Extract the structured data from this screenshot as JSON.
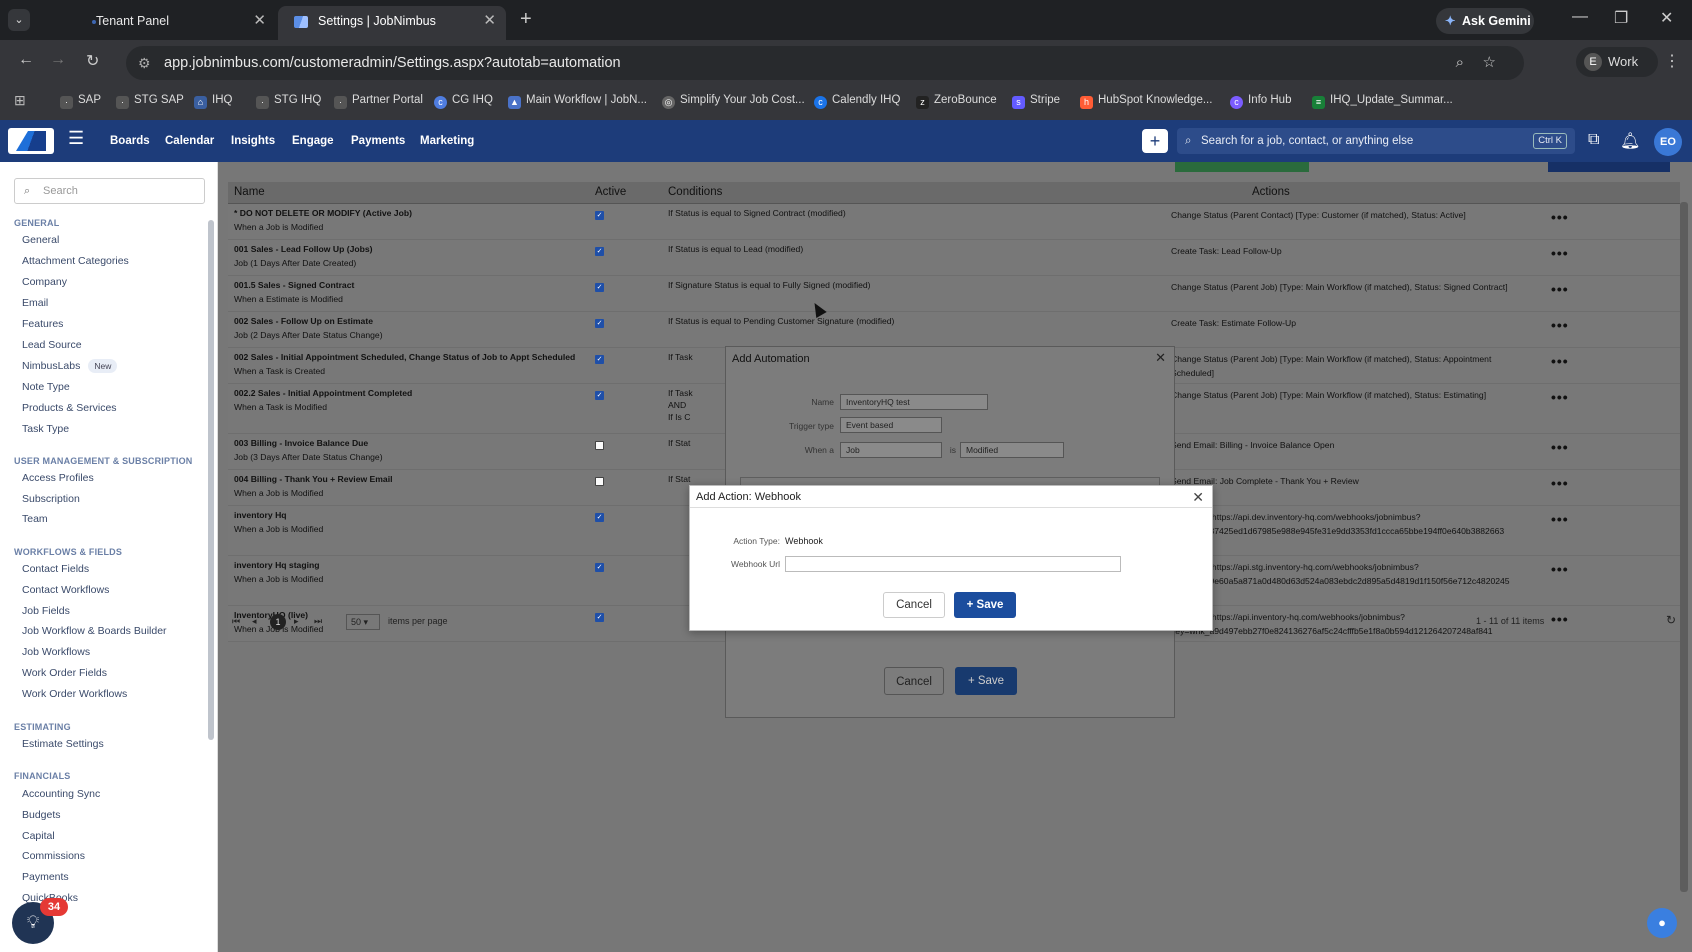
{
  "browser": {
    "tabs": [
      {
        "title": "Tenant Panel"
      },
      {
        "title": "Settings | JobNimbus"
      }
    ],
    "url": "app.jobnimbus.com/customeradmin/Settings.aspx?autotab=automation",
    "ask_gemini": "Ask Gemini",
    "profile_initial": "E",
    "profile_label": "Work",
    "bookmarks": [
      "SAP",
      "STG SAP",
      "IHQ",
      "STG IHQ",
      "Partner Portal",
      "CG IHQ",
      "Main Workflow | JobN...",
      "Simplify Your Job Cost...",
      "Calendly IHQ",
      "ZeroBounce",
      "Stripe",
      "HubSpot Knowledge...",
      "Info Hub",
      "IHQ_Update_Summar..."
    ]
  },
  "app": {
    "nav": [
      "Boards",
      "Calendar",
      "Insights",
      "Engage",
      "Payments",
      "Marketing"
    ],
    "search_placeholder": "Search for a job, contact, or anything else",
    "shortcut": "Ctrl K",
    "avatar": "EO"
  },
  "sidebar": {
    "search_placeholder": "Search",
    "sections": [
      {
        "title": "GENERAL",
        "items": [
          "General",
          "Attachment Categories",
          "Company",
          "Email",
          "Features",
          "Lead Source",
          "NimbusLabs",
          "Note Type",
          "Products & Services",
          "Task Type"
        ]
      },
      {
        "title": "USER MANAGEMENT & SUBSCRIPTION",
        "items": [
          "Access Profiles",
          "Subscription",
          "Team"
        ]
      },
      {
        "title": "WORKFLOWS & FIELDS",
        "items": [
          "Contact Fields",
          "Contact Workflows",
          "Job Fields",
          "Job Workflow & Boards Builder",
          "Job Workflows",
          "Work Order Fields",
          "Work Order Workflows"
        ]
      },
      {
        "title": "ESTIMATING",
        "items": [
          "Estimate Settings"
        ]
      },
      {
        "title": "FINANCIALS",
        "items": [
          "Accounting Sync",
          "Budgets",
          "Capital",
          "Commissions",
          "Payments",
          "QuickBooks"
        ]
      }
    ],
    "new_badge": "New",
    "help_count": "34"
  },
  "table": {
    "headers": [
      "Name",
      "Active",
      "Conditions",
      "Actions"
    ],
    "rows": [
      {
        "name": "* DO NOT DELETE OR MODIFY (Active Job)",
        "sub": "When a Job is Modified",
        "active": true,
        "cond": "If Status is equal to Signed Contract (modified)",
        "act": "Change Status (Parent Contact) [Type: Customer (if matched), Status: Active]"
      },
      {
        "name": "001 Sales - Lead Follow Up (Jobs)",
        "sub": "Job (1 Days After Date Created)",
        "active": true,
        "cond": "If Status is equal to Lead (modified)",
        "act": "Create Task: Lead Follow-Up"
      },
      {
        "name": "001.5 Sales - Signed Contract",
        "sub": "When a Estimate is Modified",
        "active": true,
        "cond": "If Signature Status is equal to Fully Signed (modified)",
        "act": "Change Status (Parent Job) [Type: Main Workflow (if matched), Status: Signed Contract]"
      },
      {
        "name": "002 Sales - Follow Up on Estimate",
        "sub": "Job (2 Days After Date Status Change)",
        "active": true,
        "cond": "If Status is equal to Pending Customer Signature (modified)",
        "act": "Create Task: Estimate Follow-Up"
      },
      {
        "name": "002 Sales - Initial Appointment Scheduled, Change Status of Job to Appt Scheduled",
        "sub": "When a Task is Created",
        "active": true,
        "cond": "If Task",
        "act": "Change Status (Parent Job) [Type: Main Workflow (if matched), Status: Appointment Scheduled]"
      },
      {
        "name": "002.2 Sales - Initial Appointment Completed",
        "sub": "When a Task is Modified",
        "active": true,
        "cond": "If Task",
        "cond2": "AND",
        "cond3": "If Is C",
        "act": "Change Status (Parent Job) [Type: Main Workflow (if matched), Status: Estimating]"
      },
      {
        "name": "003 Billing - Invoice Balance Due",
        "sub": "Job (3 Days After Date Status Change)",
        "active": false,
        "cond": "If Stat",
        "act": "Send Email: Billing - Invoice Balance Open"
      },
      {
        "name": "004 Billing - Thank You + Review Email",
        "sub": "When a Job is Modified",
        "active": false,
        "cond": "If Stat",
        "act": "Send Email: Job Complete - Thank You + Review"
      },
      {
        "name": "inventory Hq",
        "sub": "When a Job is Modified",
        "active": true,
        "cond": "",
        "act": "Webhook: https://api.dev.inventory-hq.com/webhooks/jobnimbus?key=whk_37425ed1d67985e988e945fe31e9dd3353fd1ccca65bbe194ff0e640b3882663"
      },
      {
        "name": "inventory Hq staging",
        "sub": "When a Job is Modified",
        "active": true,
        "cond": "",
        "act": "Webhook: https://api.stg.inventory-hq.com/webhooks/jobnimbus?key=whk_9e60a5a871a0d480d63d524a083ebdc2d895a5d4819d1f150f56e712c4820245"
      },
      {
        "name": "InventoryHQ (live)",
        "sub": "When a Job is Modified",
        "active": true,
        "cond": "",
        "act": "Webhook: https://api.inventory-hq.com/webhooks/jobnimbus?key=whk_a9d497ebb27f0e824136276af5c24cfffb5e1f8a0b594d121264207248af841"
      }
    ],
    "page": "1",
    "per_page": "50",
    "per_page_label": "items per page",
    "summary": "1 - 11 of 11 items"
  },
  "add_automation": {
    "title": "Add Automation",
    "name_label": "Name",
    "name_value": "InventoryHQ test",
    "trigger_label": "Trigger type",
    "trigger_value": "Event based",
    "when_label": "When a",
    "when_value": "Job",
    "is_label": "is",
    "is_value": "Modified",
    "cancel": "Cancel",
    "save": "+ Save"
  },
  "add_action": {
    "title": "Add Action: Webhook",
    "type_label": "Action Type:",
    "type_value": "Webhook",
    "url_label": "Webhook Url",
    "url_value": "",
    "cancel": "Cancel",
    "save": "+ Save"
  }
}
